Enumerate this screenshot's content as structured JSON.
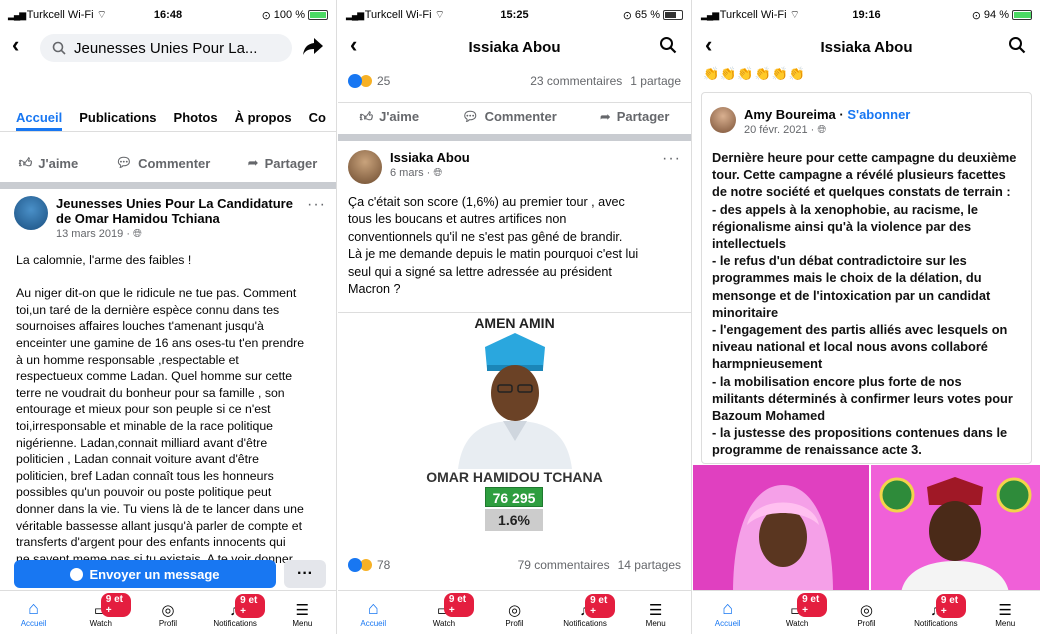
{
  "panel1": {
    "status": {
      "carrier": "Turkcell Wi-Fi",
      "time": "16:48",
      "battery": "100 %"
    },
    "search": {
      "text": "Jeunesses Unies Pour La..."
    },
    "tabs": [
      "Accueil",
      "Publications",
      "Photos",
      "À propos",
      "Co"
    ],
    "actions": {
      "like": "J'aime",
      "comment": "Commenter",
      "share": "Partager"
    },
    "post": {
      "author": "Jeunesses Unies Pour La Candidature de Omar Hamidou Tchiana",
      "date": "13 mars 2019 · ",
      "lines": [
        "La calomnie, l'arme des faibles !",
        "",
        "Au niger dit-on que le ridicule ne tue pas. Comment",
        "toi,un taré de la dernière espèce connu dans tes",
        "sournoises affaires louches t'amenant jusqu'à",
        "enceinter une gamine de 16 ans oses-tu t'en prendre",
        "à un homme responsable ,respectable et",
        "respectueux comme Ladan. Quel homme sur cette",
        "terre  ne voudrait du bonheur pour sa famille , son",
        "entourage et mieux pour son peuple si ce n'est",
        "toi,irresponsable et minable de la race politique",
        "nigérienne. Ladan,connait milliard avant d'être",
        "politicien , Ladan connait voiture avant d'être",
        "politicien, bref Ladan connaît tous les honneurs",
        "possibles qu'un pouvoir ou poste politique peut",
        "donner dans la vie. Tu viens là de te lancer dans une",
        "véritable bassesse allant jusqu'à parler de compte et",
        "transferts d'argent pour des enfants innocents qui",
        "ne savent meme pas si tu existais. A te voir donner"
      ]
    },
    "message_button": "Envoyer un message",
    "more_button": "···"
  },
  "panel2": {
    "status": {
      "carrier": "Turkcell Wi-Fi",
      "time": "15:25",
      "battery": "65 %"
    },
    "title": "Issiaka Abou",
    "top_reactions": {
      "count": "25",
      "comments": "23 commentaires",
      "shares": "1 partage"
    },
    "actions": {
      "like": "J'aime",
      "comment": "Commenter",
      "share": "Partager"
    },
    "post": {
      "author": "Issiaka Abou",
      "date": "6 mars · ",
      "lines": [
        "Ça c'était son score (1,6%) au premier tour , avec",
        "tous les boucans et autres artifices non",
        "conventionnels qu'il ne s'est pas gêné de brandir.",
        "Là je me demande depuis le matin pourquoi c'est lui",
        "seul qui a signé sa lettre adressée au président",
        "Macron ?"
      ]
    },
    "campaign": {
      "slogan": "AMEN AMIN",
      "name": "OMAR HAMIDOU TCHANA",
      "votes": "76 295",
      "percent": "1.6%"
    },
    "bottom_reactions": {
      "count": "78",
      "comments": "79 commentaires",
      "shares": "14 partages"
    }
  },
  "panel3": {
    "status": {
      "carrier": "Turkcell Wi-Fi",
      "time": "19:16",
      "battery": "94 %"
    },
    "title": "Issiaka Abou",
    "emojis": "👏👏👏👏👏👏",
    "shared": {
      "author": "Amy Boureima",
      "separator": " · ",
      "follow": "S'abonner",
      "date": "20 févr. 2021 · ",
      "lines": [
        "Dernière heure pour cette campagne du deuxième",
        "tour. Cette campagne a révélé plusieurs facettes",
        "de notre société et quelques constats de terrain :",
        "- des appels à la xenophobie, au racisme, le",
        "régionalisme ainsi qu'à la violence par des",
        "intellectuels",
        "- le refus d'un débat contradictoire sur les",
        "programmes mais le choix de la délation, du",
        "mensonge et de l'intoxication par un candidat",
        "minoritaire",
        "- l'engagement des partis alliés avec lesquels on",
        "niveau national et local nous avons collaboré",
        "harmpnieusement",
        "- la mobilisation  encore plus forte de nos",
        "militants déterminés à confirmer leurs votes pour",
        "Bazoum Mohamed",
        "- la justesse des propositions contenues dans le",
        "programme de renaissance acte 3."
      ]
    }
  },
  "tabbar": {
    "items": [
      "Accueil",
      "Watch",
      "Profil",
      "Notifications",
      "Menu"
    ],
    "badge": "9 et +"
  },
  "colors": {
    "accent": "#1877f2",
    "badge": "#e41e3f",
    "votes_green": "#2e9e3f"
  }
}
